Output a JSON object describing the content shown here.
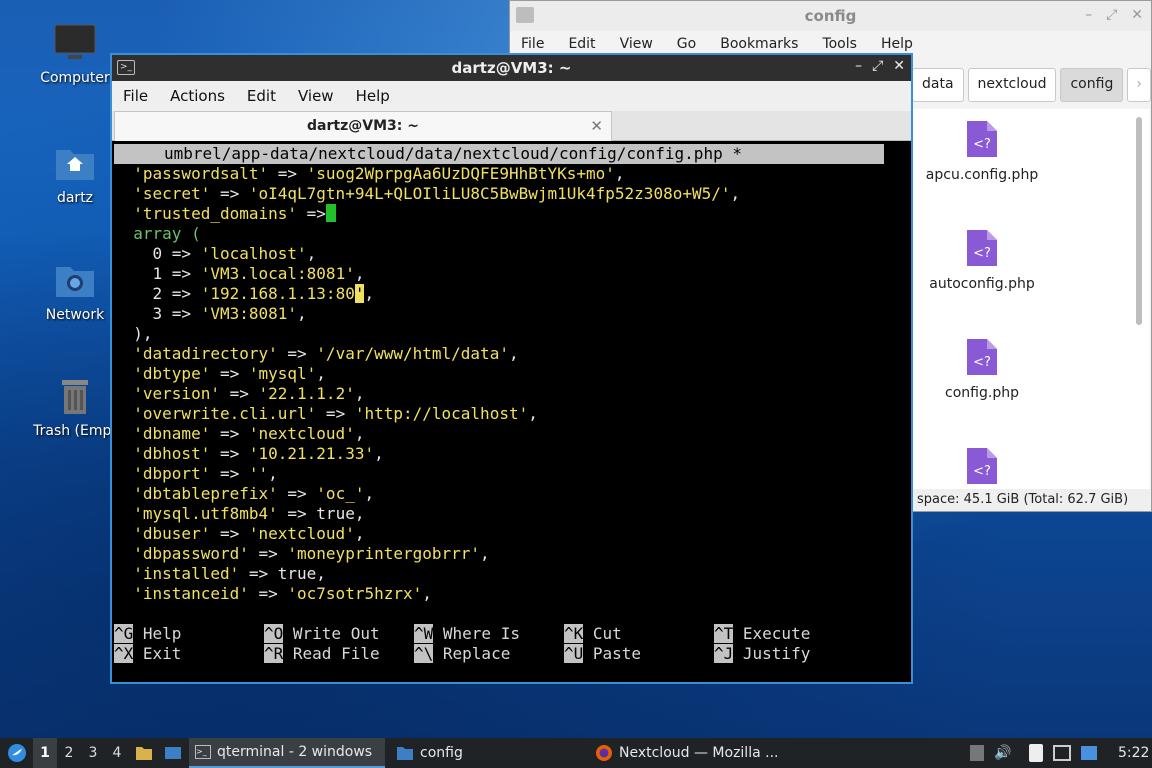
{
  "desktop": {
    "icons": [
      {
        "label": "Computer"
      },
      {
        "label": "dartz"
      },
      {
        "label": "Network"
      },
      {
        "label": "Trash (Empt"
      }
    ]
  },
  "file_manager": {
    "title": "config",
    "menu": [
      "File",
      "Edit",
      "View",
      "Go",
      "Bookmarks",
      "Tools",
      "Help"
    ],
    "path": [
      "data",
      "nextcloud",
      "config"
    ],
    "files": [
      "apcu.config.php",
      "autoconfig.php",
      "config.php",
      ""
    ],
    "status": "space: 45.1 GiB (Total: 62.7 GiB)"
  },
  "terminal": {
    "title": "dartz@VM3: ~",
    "menu": [
      "File",
      "Actions",
      "Edit",
      "View",
      "Help"
    ],
    "tab_title": "dartz@VM3: ~",
    "nano_header": "umbrel/app-data/nextcloud/data/nextcloud/config/config.php *",
    "lines": {
      "l1a": "  'passwordsalt'",
      "l1b": " => ",
      "l1c": "'suog2WprpgAa6UzDQFE9HhBtYKs+mo'",
      "l1d": ",",
      "l2a": "  'secret'",
      "l2b": " => ",
      "l2c": "'oI4qL7gtn+94L+QLOIliLU8C5BwBwjm1Uk4fp52z308o+W5/'",
      "l2d": ",",
      "l3a": "  'trusted_domains'",
      "l3b": " =>",
      "l4": "  array (",
      "l5a": "    0 => ",
      "l5b": "'localhost'",
      "l5c": ",",
      "l6a": "    1 => ",
      "l6b": "'VM3.local:8081'",
      "l6c": ",",
      "l7a": "    2 => ",
      "l7b": "'192.168.1.13:80",
      "l7cur": "'",
      "l7c": ",",
      "l8a": "    3 => ",
      "l8b": "'VM3:8081'",
      "l8c": ",",
      "l9": "  ),",
      "l10a": "  'datadirectory'",
      "l10b": " => ",
      "l10c": "'/var/www/html/data'",
      "l10d": ",",
      "l11a": "  'dbtype'",
      "l11b": " => ",
      "l11c": "'mysql'",
      "l11d": ",",
      "l12a": "  'version'",
      "l12b": " => ",
      "l12c": "'22.1.1.2'",
      "l12d": ",",
      "l13a": "  'overwrite.cli.url'",
      "l13b": " => ",
      "l13c": "'http://localhost'",
      "l13d": ",",
      "l14a": "  'dbname'",
      "l14b": " => ",
      "l14c": "'nextcloud'",
      "l14d": ",",
      "l15a": "  'dbhost'",
      "l15b": " => ",
      "l15c": "'10.21.21.33'",
      "l15d": ",",
      "l16a": "  'dbport'",
      "l16b": " => ",
      "l16c": "''",
      "l16d": ",",
      "l17a": "  'dbtableprefix'",
      "l17b": " => ",
      "l17c": "'oc_'",
      "l17d": ",",
      "l18a": "  'mysql.utf8mb4'",
      "l18b": " => true,",
      "l19a": "  'dbuser'",
      "l19b": " => ",
      "l19c": "'nextcloud'",
      "l19d": ",",
      "l20a": "  'dbpassword'",
      "l20b": " => ",
      "l20c": "'moneyprintergobrrr'",
      "l20d": ",",
      "l21a": "  'installed'",
      "l21b": " => true,",
      "l22a": "  'instanceid'",
      "l22b": " => ",
      "l22c": "'oc7sotr5hzrx'",
      "l22d": ","
    },
    "shortcuts": [
      [
        {
          "key": "^G",
          "label": " Help"
        },
        {
          "key": "^O",
          "label": " Write Out"
        },
        {
          "key": "^W",
          "label": " Where Is"
        },
        {
          "key": "^K",
          "label": " Cut"
        },
        {
          "key": "^T",
          "label": " Execute"
        }
      ],
      [
        {
          "key": "^X",
          "label": " Exit"
        },
        {
          "key": "^R",
          "label": " Read File"
        },
        {
          "key": "^\\",
          "label": " Replace"
        },
        {
          "key": "^U",
          "label": " Paste"
        },
        {
          "key": "^J",
          "label": " Justify"
        }
      ]
    ]
  },
  "taskbar": {
    "workspaces": [
      "1",
      "2",
      "3",
      "4"
    ],
    "tasks": [
      {
        "label": "qterminal - 2 windows"
      },
      {
        "label": "config"
      },
      {
        "label": "Nextcloud — Mozilla ..."
      }
    ],
    "clock": "5:22"
  },
  "colors": {
    "terminal_border": "#3b8fd6",
    "code_yellow": "#f0e060",
    "code_green": "#6cc36c"
  }
}
